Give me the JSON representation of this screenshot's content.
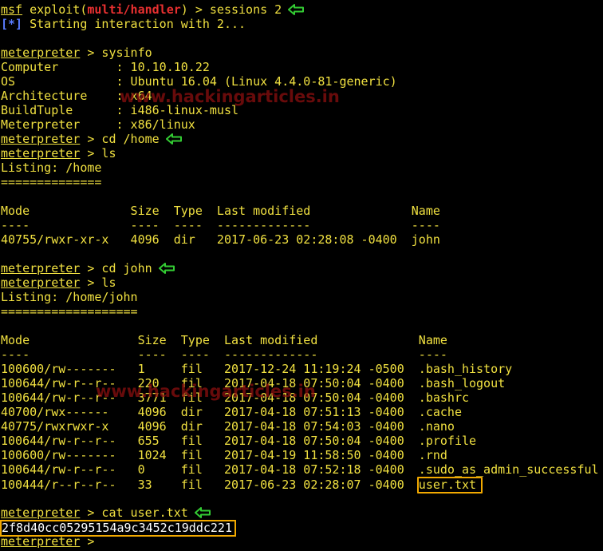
{
  "watermark": "www.hackingarticles.in",
  "terminal": {
    "lines": [
      {
        "id": "l0",
        "segments": [
          {
            "t": "msf",
            "c": "y u"
          },
          {
            "t": " exploit(",
            "c": "y"
          },
          {
            "t": "multi/handler",
            "c": "r"
          },
          {
            "t": ") > sessions 2",
            "c": "y"
          }
        ],
        "arrow": true
      },
      {
        "id": "l1",
        "segments": [
          {
            "t": "[*]",
            "c": "b"
          },
          {
            "t": " Starting interaction with 2...",
            "c": "y"
          }
        ]
      },
      {
        "id": "l2",
        "segments": []
      },
      {
        "id": "l3",
        "segments": [
          {
            "t": "meterpreter",
            "c": "y u"
          },
          {
            "t": " > sysinfo",
            "c": "y"
          }
        ]
      },
      {
        "id": "l4",
        "segments": [
          {
            "t": "Computer        : 10.10.10.22",
            "c": "y"
          }
        ]
      },
      {
        "id": "l5",
        "segments": [
          {
            "t": "OS              : Ubuntu 16.04 (Linux 4.4.0-81-generic)",
            "c": "y"
          }
        ]
      },
      {
        "id": "l6",
        "segments": [
          {
            "t": "Architecture    : x64",
            "c": "y"
          }
        ]
      },
      {
        "id": "l7",
        "segments": [
          {
            "t": "BuildTuple      : i486-linux-musl",
            "c": "y"
          }
        ]
      },
      {
        "id": "l8",
        "segments": [
          {
            "t": "Meterpreter     : x86/linux",
            "c": "y"
          }
        ]
      },
      {
        "id": "l9",
        "segments": [
          {
            "t": "meterpreter",
            "c": "y u"
          },
          {
            "t": " > cd /home",
            "c": "y"
          }
        ],
        "arrow": true
      },
      {
        "id": "l10",
        "segments": [
          {
            "t": "meterpreter",
            "c": "y u"
          },
          {
            "t": " > ls",
            "c": "y"
          }
        ]
      },
      {
        "id": "l11",
        "segments": [
          {
            "t": "Listing: /home",
            "c": "y"
          }
        ]
      },
      {
        "id": "l12",
        "segments": [
          {
            "t": "==============",
            "c": "y"
          }
        ]
      },
      {
        "id": "l13",
        "segments": []
      },
      {
        "id": "l14",
        "segments": [
          {
            "t": "Mode              Size  Type  Last modified              Name",
            "c": "y"
          }
        ]
      },
      {
        "id": "l15",
        "segments": [
          {
            "t": "----              ----  ----  -------------              ----",
            "c": "y"
          }
        ]
      },
      {
        "id": "l16",
        "segments": [
          {
            "t": "40755/rwxr-xr-x   4096  dir   2017-06-23 02:28:08 -0400  john",
            "c": "y"
          }
        ]
      },
      {
        "id": "l17",
        "segments": []
      },
      {
        "id": "l18",
        "segments": [
          {
            "t": "meterpreter",
            "c": "y u"
          },
          {
            "t": " > cd john",
            "c": "y"
          }
        ],
        "arrow": true
      },
      {
        "id": "l19",
        "segments": [
          {
            "t": "meterpreter",
            "c": "y u"
          },
          {
            "t": " > ls",
            "c": "y"
          }
        ]
      },
      {
        "id": "l20",
        "segments": [
          {
            "t": "Listing: /home/john",
            "c": "y"
          }
        ]
      },
      {
        "id": "l21",
        "segments": [
          {
            "t": "===================",
            "c": "y"
          }
        ]
      },
      {
        "id": "l22",
        "segments": []
      },
      {
        "id": "l23",
        "segments": [
          {
            "t": "Mode               Size  Type  Last modified              Name",
            "c": "y"
          }
        ]
      },
      {
        "id": "l24",
        "segments": [
          {
            "t": "----               ----  ----  -------------              ----",
            "c": "y"
          }
        ]
      },
      {
        "id": "l25",
        "segments": [
          {
            "t": "100600/rw-------   1     fil   2017-12-24 11:19:24 -0500  .bash_history",
            "c": "y"
          }
        ]
      },
      {
        "id": "l26",
        "segments": [
          {
            "t": "100644/rw-r--r--   220   fil   2017-04-18 07:50:04 -0400  .bash_logout",
            "c": "y"
          }
        ]
      },
      {
        "id": "l27",
        "segments": [
          {
            "t": "100644/rw-r--r--   3771  fil   2017-04-18 07:50:04 -0400  .bashrc",
            "c": "y"
          }
        ]
      },
      {
        "id": "l28",
        "segments": [
          {
            "t": "40700/rwx------    4096  dir   2017-04-18 07:51:13 -0400  .cache",
            "c": "y"
          }
        ]
      },
      {
        "id": "l29",
        "segments": [
          {
            "t": "40775/rwxrwxr-x    4096  dir   2017-04-18 07:54:03 -0400  .nano",
            "c": "y"
          }
        ]
      },
      {
        "id": "l30",
        "segments": [
          {
            "t": "100644/rw-r--r--   655   fil   2017-04-18 07:50:04 -0400  .profile",
            "c": "y"
          }
        ]
      },
      {
        "id": "l31",
        "segments": [
          {
            "t": "100600/rw-------   1024  fil   2017-04-19 11:58:50 -0400  .rnd",
            "c": "y"
          }
        ]
      },
      {
        "id": "l32",
        "segments": [
          {
            "t": "100644/rw-r--r--   0     fil   2017-04-18 07:52:18 -0400  .sudo_as_admin_successful",
            "c": "y"
          }
        ]
      },
      {
        "id": "l33",
        "segments": [
          {
            "t": "100444/r--r--r--   33    fil   2017-06-23 02:28:07 -0400  ",
            "c": "y"
          },
          {
            "t": "user.txt",
            "c": "y hl"
          }
        ]
      },
      {
        "id": "l34",
        "segments": []
      },
      {
        "id": "l35",
        "segments": [
          {
            "t": "meterpreter",
            "c": "y u"
          },
          {
            "t": " > cat user.txt",
            "c": "y"
          }
        ],
        "arrow": true
      },
      {
        "id": "l36",
        "segments": [
          {
            "t": "2f8d40cc05295154a9c3452c19ddc221",
            "c": "w hl-flag"
          }
        ]
      },
      {
        "id": "l37",
        "segments": [
          {
            "t": "meterpreter",
            "c": "y u"
          },
          {
            "t": " > ",
            "c": "y"
          }
        ]
      }
    ]
  },
  "colors": {
    "background": "#000000",
    "text_yellow": "#f0e040",
    "text_red": "#e83030",
    "text_blue": "#5a7cff",
    "arrow_green": "#33cc33",
    "highlight_box": "#f2a900",
    "watermark": "#8b0f0f"
  },
  "icons": {
    "arrow": "left-arrow-icon"
  }
}
